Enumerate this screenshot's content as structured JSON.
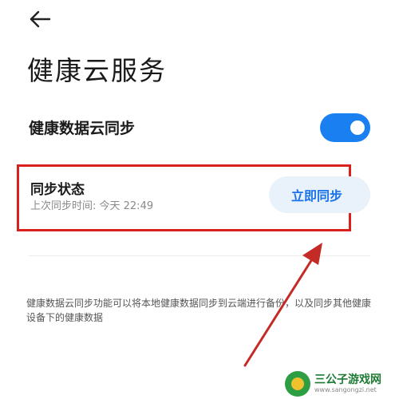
{
  "header": {
    "back_icon": "arrow-left-icon",
    "title": "健康云服务"
  },
  "cloud_sync": {
    "label": "健康数据云同步",
    "enabled": true,
    "toggle_color": "#1a7ff0"
  },
  "sync_status": {
    "title": "同步状态",
    "last_sync": "上次同步时间: 今天 22:49",
    "button_label": "立即同步"
  },
  "description": "健康数据云同步功能可以将本地健康数据同步到云端进行备份，以及同步其他健康设备下的健康数据",
  "annotation": {
    "box_color": "#d8201c",
    "arrow_color": "#c42a26"
  },
  "watermark": {
    "name": "三公子游戏网",
    "url": "www.sangongzi.net"
  }
}
